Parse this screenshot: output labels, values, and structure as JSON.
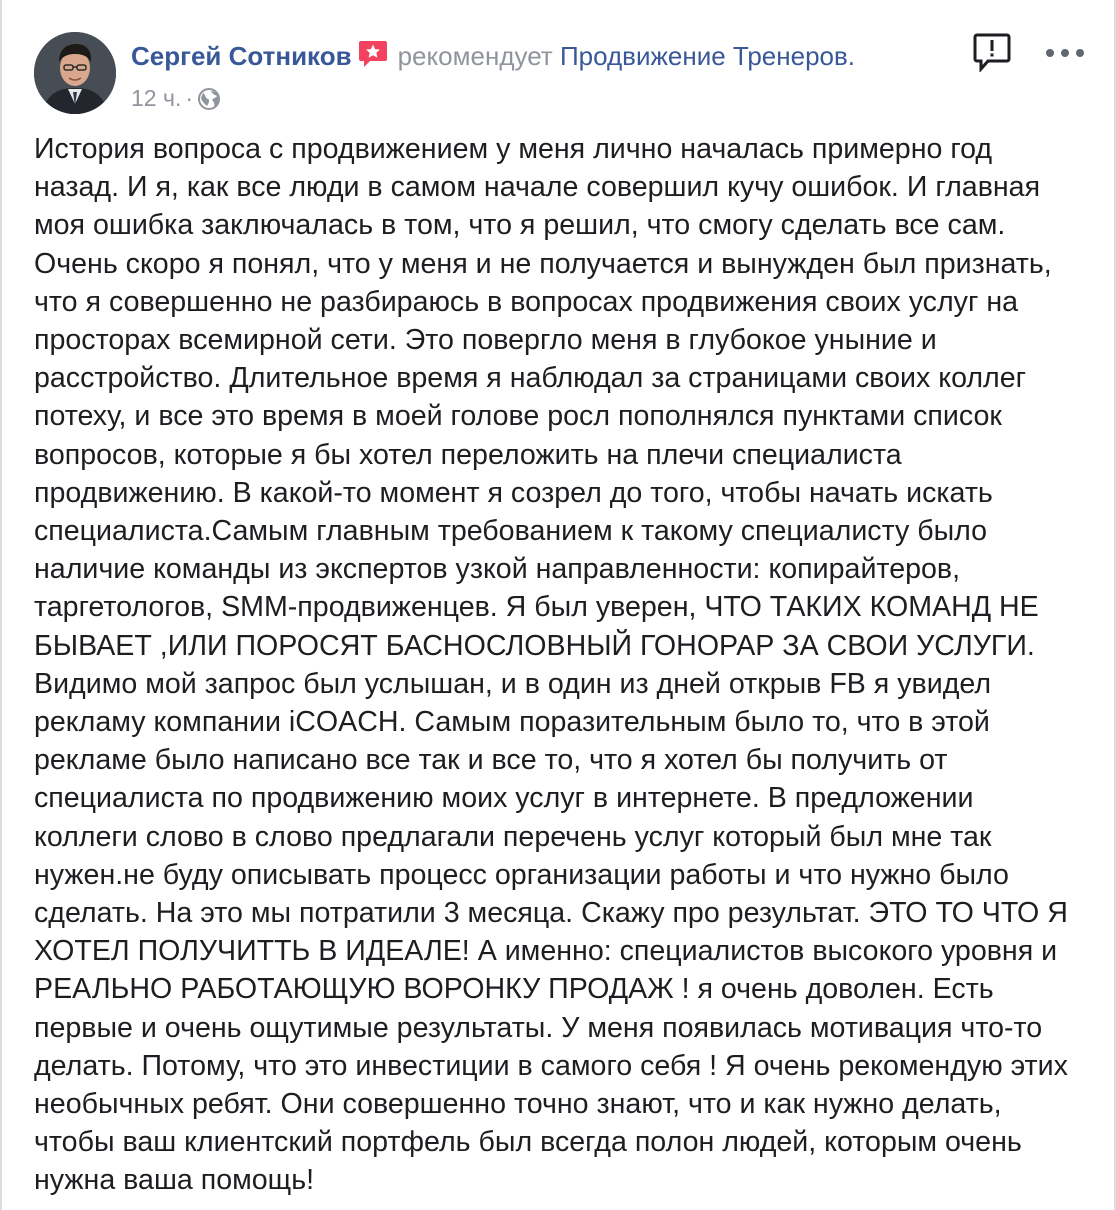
{
  "post": {
    "author_name": "Сергей Сотников",
    "action_verb": "рекомендует",
    "page_name": "Продвижение Тренеров.",
    "timestamp": "12 ч.",
    "separator": "·",
    "badge_icon": "recommendation-star-icon",
    "privacy_icon": "globe-icon",
    "report_icon": "report-icon",
    "more_icon": "more-options-icon",
    "body": "История вопроса с продвижением у меня лично началась примерно год назад. И я, как все люди в самом начале совершил кучу ошибок. И главная моя ошибка заключалась в том, что я решил, что смогу сделать все сам. Очень скоро я понял, что у меня и не получается и вынужден был признать, что я совершенно не разбираюсь в вопросах продвижения своих услуг на просторах всемирной сети. Это повергло меня в глубокое уныние и расстройство. Длительное время я наблюдал за страницами своих коллег потеху, и все это время в моей голове росл пополнялся пунктами список вопросов, которые я бы хотел переложить на плечи специалиста продвижению. В какой-то момент я созрел до того, чтобы начать искать специалиста.Самым главным требованием к такому специалисту было наличие команды из экспертов узкой направленности: копирайтеров, таргетологов, SMM-продвиженцев. Я был уверен, ЧТО ТАКИХ КОМАНД НЕ БЫВАЕТ ,ИЛИ ПОРОСЯТ БАСНОСЛОВНЫЙ ГОНОРАР ЗА СВОИ УСЛУГИ. Видимо мой запрос был услышан, и в один из дней открыв FB я увидел рекламу компании iCOACH. Самым поразительным было то, что в этой рекламе было написано все так и все то, что я хотел бы получить от специалиста по продвижению моих услуг в интернете. В предложении коллеги слово в слово предлагали перечень услуг который был мне так нужен.не буду описывать процесс организации работы и что нужно было сделать. На это мы потратили 3 месяца. Скажу про результат. ЭТО ТО ЧТО Я ХОТЕЛ ПОЛУЧИТТЬ В ИДЕАЛЕ! А именно: специалистов высокого уровня и РЕАЛЬНО РАБОТАЮЩУЮ ВОРОНКУ ПРОДАЖ ! я очень доволен. Есть первые и очень ощутимые результаты. У меня появилась мотивация что-то делать. Потому, что это инвестиции в самого себя ! Я очень рекомендую этих необычных ребят. Они совершенно точно знают, что и как нужно делать, чтобы ваш клиентский портфель был всегда полон людей, которым очень нужна ваша помощь!"
  },
  "colors": {
    "link": "#385898",
    "meta": "#90949c",
    "text": "#1c1e21",
    "badge": "#f3425f",
    "border": "#dadde1"
  }
}
